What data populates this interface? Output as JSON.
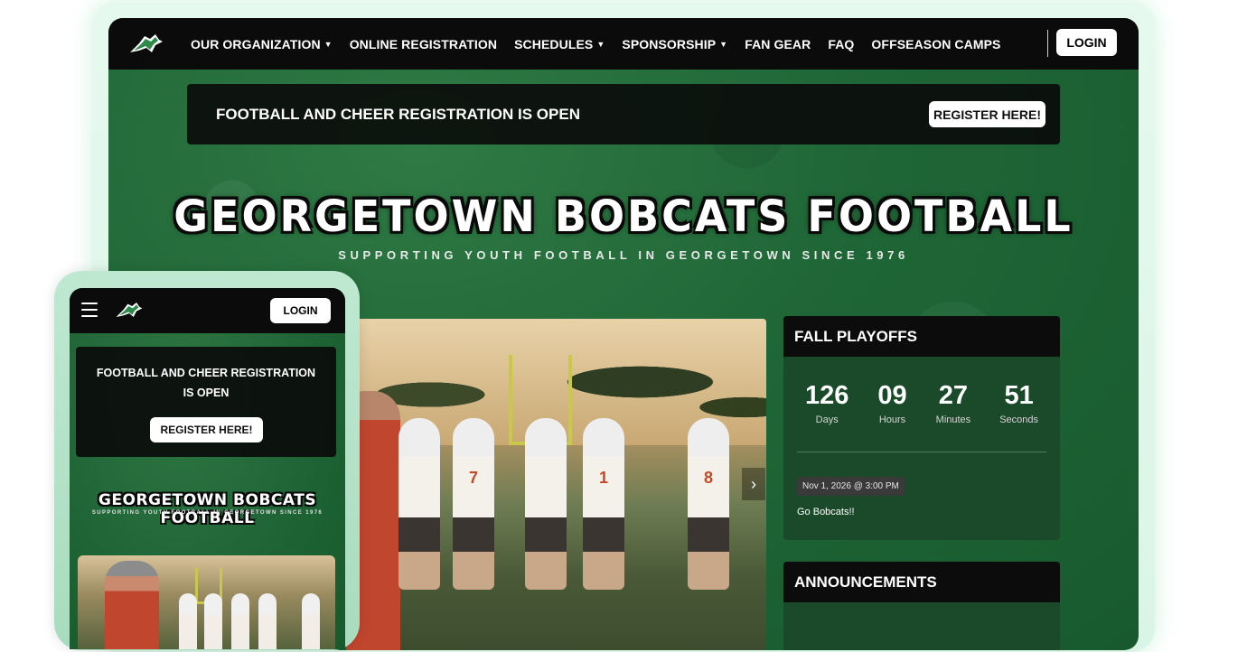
{
  "desktop": {
    "nav": {
      "items": [
        {
          "label": "OUR ORGANIZATION",
          "has_dropdown": true
        },
        {
          "label": "ONLINE REGISTRATION",
          "has_dropdown": false
        },
        {
          "label": "SCHEDULES",
          "has_dropdown": true
        },
        {
          "label": "SPONSORSHIP",
          "has_dropdown": true
        },
        {
          "label": "FAN GEAR",
          "has_dropdown": false
        },
        {
          "label": "FAQ",
          "has_dropdown": false
        },
        {
          "label": "OFFSEASON CAMPS",
          "has_dropdown": false
        }
      ],
      "login_label": "LOGIN"
    },
    "banner": {
      "text": "FOOTBALL AND CHEER REGISTRATION IS OPEN",
      "button_label": "REGISTER HERE!"
    },
    "hero": {
      "title": "GEORGETOWN BOBCATS FOOTBALL",
      "subtitle": "SUPPORTING YOUTH FOOTBALL IN GEORGETOWN SINCE 1976"
    },
    "playoffs": {
      "title": "FALL PLAYOFFS",
      "countdown": [
        {
          "value": "126",
          "label": "Days"
        },
        {
          "value": "09",
          "label": "Hours"
        },
        {
          "value": "27",
          "label": "Minutes"
        },
        {
          "value": "51",
          "label": "Seconds"
        }
      ],
      "event_date": "Nov 1, 2026 @ 3:00 PM",
      "event_text": "Go Bobcats!!"
    },
    "announcements": {
      "title": "ANNOUNCEMENTS"
    },
    "photo_numbers": [
      "7",
      "1",
      "8"
    ]
  },
  "mobile": {
    "login_label": "LOGIN",
    "banner": {
      "text": "FOOTBALL AND CHEER REGISTRATION IS OPEN",
      "button_label": "REGISTER HERE!"
    },
    "hero": {
      "title": "GEORGETOWN BOBCATS FOOTBALL",
      "subtitle": "SUPPORTING YOUTH FOOTBALL IN GEORGETOWN SINCE 1976"
    }
  },
  "colors": {
    "brand_green": "#1f6636",
    "nav_black": "#0b0b0b",
    "panel_green": "#1b4a2a"
  },
  "icons": {
    "logo": "bobcat-logo-icon",
    "dropdown": "caret-down-icon",
    "carousel_next": "chevron-right-icon",
    "menu": "hamburger-menu-icon"
  }
}
